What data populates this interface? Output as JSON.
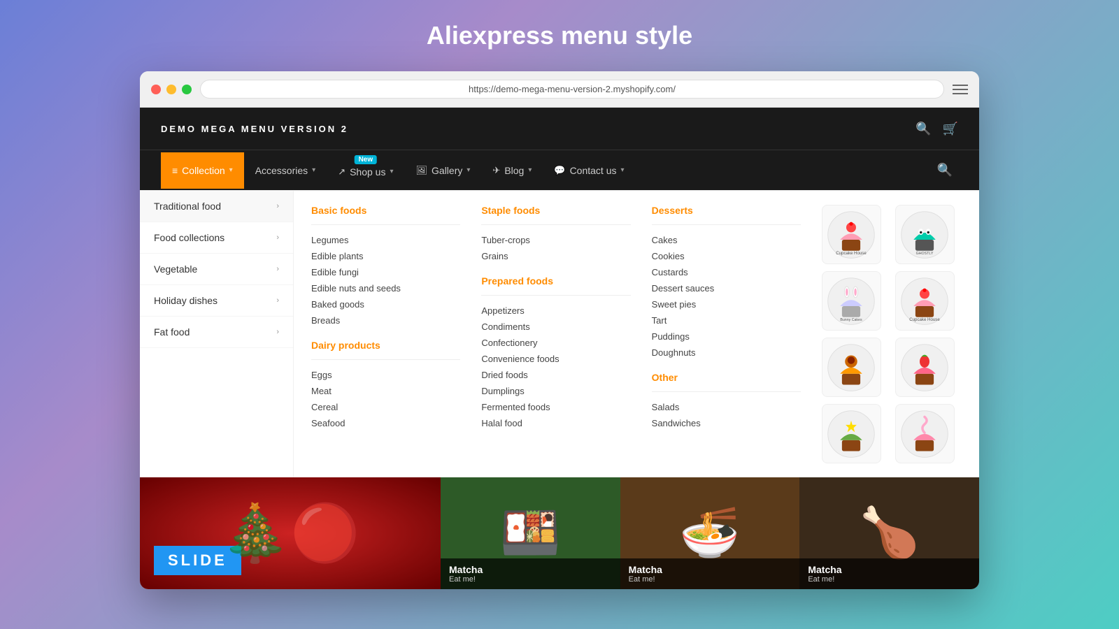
{
  "page": {
    "title": "Aliexpress menu style"
  },
  "browser": {
    "url": "https://demo-mega-menu-version-2.myshopify.com/",
    "hamburger_label": "menu"
  },
  "navbar": {
    "brand": "DEMO MEGA MENU VERSION 2",
    "search_icon": "🔍",
    "cart_icon": "🛒"
  },
  "menu_bar": {
    "items": [
      {
        "label": "Collection",
        "icon": "≡",
        "active": true,
        "has_dropdown": true,
        "badge": null
      },
      {
        "label": "Accessories",
        "icon": null,
        "active": false,
        "has_dropdown": true,
        "badge": null
      },
      {
        "label": "Shop us",
        "icon": "↗",
        "active": false,
        "has_dropdown": true,
        "badge": "New"
      },
      {
        "label": "Gallery",
        "icon": "🖼",
        "active": false,
        "has_dropdown": true,
        "badge": null
      },
      {
        "label": "Blog",
        "icon": "✈",
        "active": false,
        "has_dropdown": true,
        "badge": null
      },
      {
        "label": "Contact us",
        "icon": "💬",
        "active": false,
        "has_dropdown": true,
        "badge": null
      }
    ]
  },
  "mega_menu": {
    "sidebar": {
      "items": [
        {
          "label": "Traditional food",
          "active": true
        },
        {
          "label": "Food collections",
          "active": false
        },
        {
          "label": "Vegetable",
          "active": false
        },
        {
          "label": "Holiday dishes",
          "active": false
        },
        {
          "label": "Fat food",
          "active": false
        }
      ]
    },
    "columns": [
      {
        "title": "Basic foods",
        "items": [
          "Legumes",
          "Edible plants",
          "Edible fungi",
          "Edible nuts and seeds",
          "Baked goods",
          "Breads"
        ],
        "section2_title": "Dairy products",
        "section2_items": [
          "Eggs",
          "Meat",
          "Cereal",
          "Seafood"
        ]
      },
      {
        "title": "Staple foods",
        "items": [
          "Tuber-crops",
          "Grains"
        ],
        "section2_title": "Prepared foods",
        "section2_items": [
          "Appetizers",
          "Condiments",
          "Confectionery",
          "Convenience foods",
          "Dried foods",
          "Dumplings",
          "Fermented foods",
          "Halal food"
        ]
      },
      {
        "title": "Desserts",
        "items": [
          "Cakes",
          "Cookies",
          "Custards",
          "Dessert sauces",
          "Sweet pies",
          "Tart",
          "Puddings",
          "Doughnuts"
        ],
        "section2_title": "Other",
        "section2_items": [
          "Salads",
          "Sandwiches"
        ]
      }
    ],
    "images": [
      {
        "emoji": "🧁",
        "label": "Cupcake House 1"
      },
      {
        "emoji": "👻",
        "label": "Ghostly Cupcakes"
      },
      {
        "emoji": "🐰",
        "label": "Bunny Cakes"
      },
      {
        "emoji": "🧁",
        "label": "Cupcake House 2"
      },
      {
        "emoji": "🍫",
        "label": "Chocolate Cupcake"
      },
      {
        "emoji": "🍓",
        "label": "Strawberry Cupcake"
      },
      {
        "emoji": "🎄",
        "label": "Christmas Cupcake"
      },
      {
        "emoji": "🍦",
        "label": "Mint Cupcake"
      }
    ]
  },
  "content": {
    "slide_label": "SLIDE",
    "food_items": [
      {
        "emoji": "🍱",
        "title": "Matcha",
        "sub": "Eat me!"
      },
      {
        "emoji": "🍜",
        "title": "Matcha",
        "sub": "Eat me!"
      },
      {
        "emoji": "🍗",
        "title": "Matcha",
        "sub": "Eat me!"
      }
    ]
  }
}
